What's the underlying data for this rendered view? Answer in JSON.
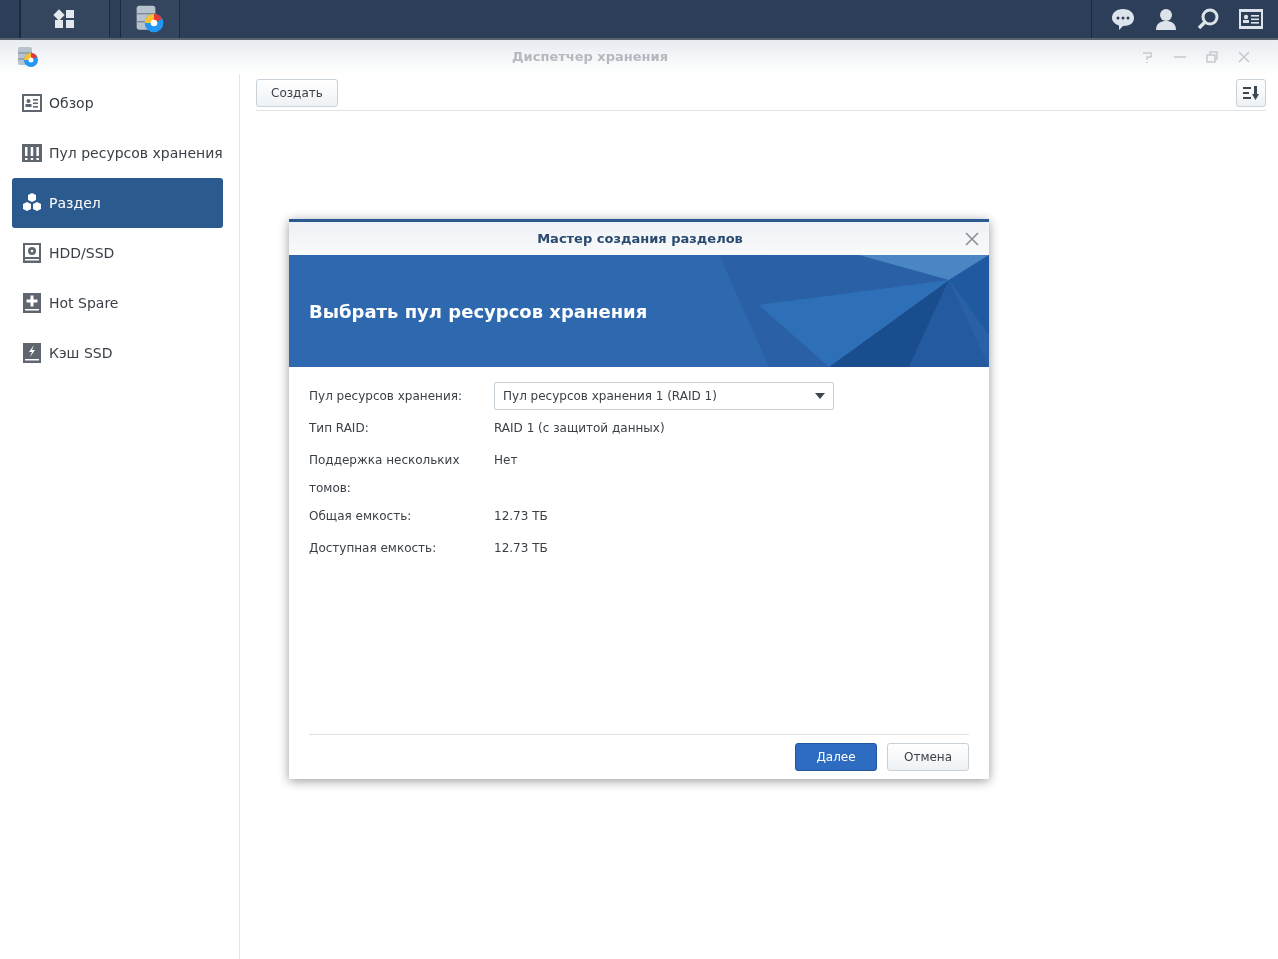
{
  "window": {
    "title": "Диспетчер хранения"
  },
  "toolbar": {
    "create_button": "Создать"
  },
  "sidebar": {
    "items": [
      {
        "label": "Обзор",
        "selected": false
      },
      {
        "label": "Пул ресурсов хранения",
        "selected": false
      },
      {
        "label": "Раздел",
        "selected": true
      },
      {
        "label": "HDD/SSD",
        "selected": false
      },
      {
        "label": "Hot Spare",
        "selected": false
      },
      {
        "label": "Кэш SSD",
        "selected": false
      }
    ]
  },
  "dialog": {
    "title": "Мастер создания разделов",
    "heading": "Выбрать пул ресурсов хранения",
    "fields": [
      {
        "kind": "select",
        "label": "Пул ресурсов хранения:",
        "value": "Пул ресурсов хранения 1 (RAID 1)"
      },
      {
        "kind": "text",
        "label": "Тип RAID:",
        "value": "RAID 1 (с защитой данных)"
      },
      {
        "kind": "text",
        "label": "Поддержка нескольких томов:",
        "value": "Нет"
      },
      {
        "kind": "text",
        "label": "Общая емкость:",
        "value": "12.73 ТБ"
      },
      {
        "kind": "text",
        "label": "Доступная емкость:",
        "value": "12.73 ТБ"
      }
    ],
    "buttons": [
      {
        "label": "Далее",
        "kind": "primary"
      },
      {
        "label": "Отмена",
        "kind": "secondary"
      }
    ]
  }
}
